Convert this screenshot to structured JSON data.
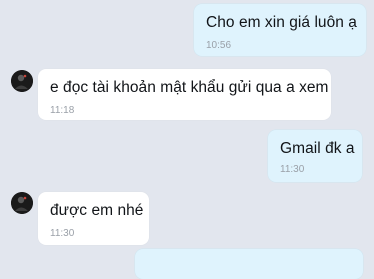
{
  "conversation": {
    "messages": [
      {
        "direction": "outgoing",
        "text": "Cho em xin giá luôn ạ",
        "time": "10:56"
      },
      {
        "direction": "incoming",
        "text": "e đọc tài khoản mật khẩu gửi qua a xem",
        "time": "11:18"
      },
      {
        "direction": "outgoing",
        "text": "Gmail đk a",
        "time": "11:30"
      },
      {
        "direction": "incoming",
        "text": "được em nhé",
        "time": "11:30"
      }
    ]
  },
  "colors": {
    "background": "#e2e6ee",
    "outgoing_bubble": "#dff3fd",
    "incoming_bubble": "#ffffff",
    "timestamp": "#9aa0a8"
  },
  "icons": {
    "contact_avatar": "avatar-icon"
  }
}
